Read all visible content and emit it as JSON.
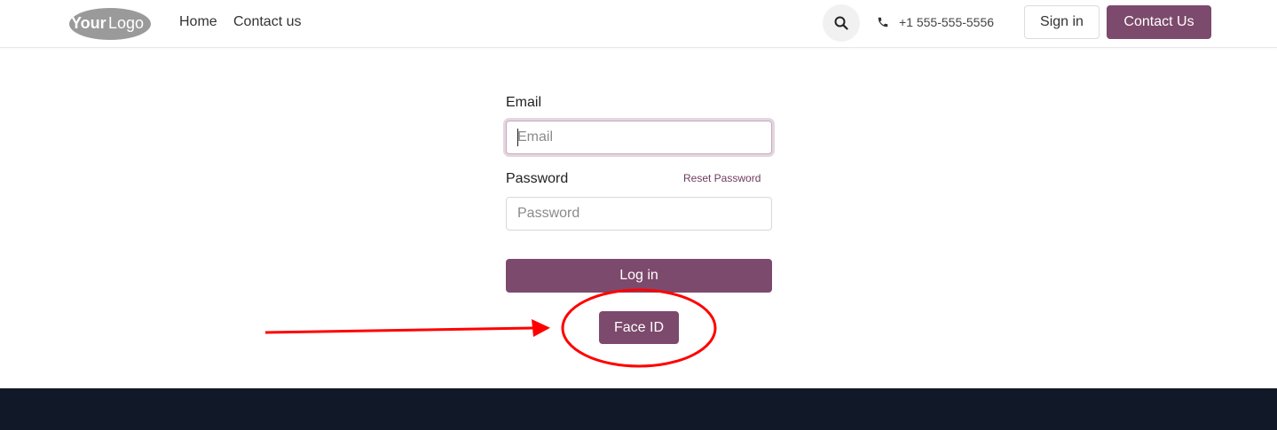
{
  "header": {
    "logo_text": "YourLogo",
    "nav": [
      "Home",
      "Contact us"
    ],
    "search_icon": "search-icon",
    "phone_icon": "phone-icon",
    "phone_number": "+1 555-555-5556",
    "signin_label": "Sign in",
    "contact_label": "Contact Us"
  },
  "form": {
    "email_label": "Email",
    "email_placeholder": "Email",
    "email_value": "",
    "password_label": "Password",
    "password_placeholder": "Password",
    "password_value": "",
    "reset_label": "Reset Password",
    "login_label": "Log in",
    "faceid_label": "Face ID"
  },
  "colors": {
    "brand": "#7c4a6c",
    "footer": "#111827",
    "annotation": "#ff0000"
  }
}
